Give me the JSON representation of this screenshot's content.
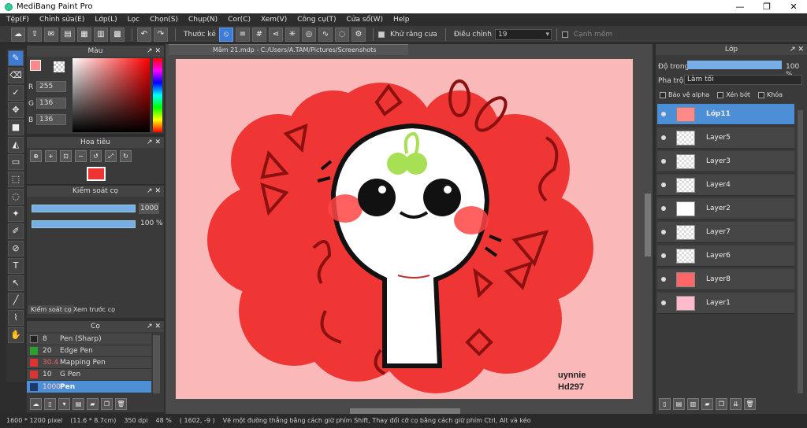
{
  "window": {
    "title": "MediBang Paint Pro",
    "minimize": "—",
    "restore": "❐",
    "close": "✕"
  },
  "menu": [
    "Tệp(F)",
    "Chỉnh sửa(E)",
    "Lớp(L)",
    "Lọc",
    "Chọn(S)",
    "Chụp(N)",
    "Cor(C)",
    "Xem(V)",
    "Công cụ(T)",
    "Cửa sổ(W)",
    "Help"
  ],
  "toolbar": {
    "ruler_label": "Thước kẻ",
    "antialias_label": "Khử răng cưa",
    "adjust_label": "Điều chỉnh",
    "adjust_value": "19",
    "sharp_edge_label": "Cạnh mềm"
  },
  "color_panel": {
    "title": "Màu",
    "r_label": "R",
    "r_value": "255",
    "g_label": "G",
    "g_value": "136",
    "b_label": "B",
    "b_value": "136",
    "primary": "#ff8888"
  },
  "navigator_panel": {
    "title": "Hoa tiêu"
  },
  "brush_control_panel": {
    "title": "Kiểm soát cọ",
    "size_value": "1000",
    "opacity_value": "100 %",
    "tab_control": "Kiểm soát cọ",
    "tab_preview": "Xem trước cọ"
  },
  "brush_panel": {
    "title": "Cọ",
    "items": [
      {
        "size": "8",
        "name": "Pen (Sharp)",
        "color": "#222222"
      },
      {
        "size": "20",
        "name": "Edge Pen",
        "color": "#2ca02c"
      },
      {
        "size": "30.4",
        "name": "Mapping Pen",
        "color": "#d33"
      },
      {
        "size": "10",
        "name": "G Pen",
        "color": "#d33"
      },
      {
        "size": "1000",
        "name": "Pen",
        "color": "#1e3a6a"
      }
    ]
  },
  "document_tab": "Mầm 21.mdp - C:/Users/A.TAM/Pictures/Screenshots",
  "signature": "uynnie\nHd297",
  "layer_panel": {
    "title": "Lớp",
    "opacity_label": "Độ trong",
    "opacity_value": "100 %",
    "blend_label": "Pha trộn",
    "blend_value": "Làm tối",
    "protect_alpha": "Bảo vệ alpha",
    "clipping": "Xén bớt",
    "lock": "Khóa",
    "layers": [
      "Lớp11",
      "Layer5",
      "Layer3",
      "Layer4",
      "Layer2",
      "Layer7",
      "Layer6",
      "Layer8",
      "Layer1"
    ]
  },
  "status": {
    "size": "1600 * 1200 pixel",
    "physical": "(11.6 * 8.7cm)",
    "dpi": "350 dpi",
    "zoom": "48 %",
    "coords": "( 1602, -9 )",
    "hint": "Vẽ một đường thẳng bằng cách giữ phím Shift, Thay đổi cỡ cọ bằng cách giữ phím Ctrl, Alt và kéo"
  }
}
